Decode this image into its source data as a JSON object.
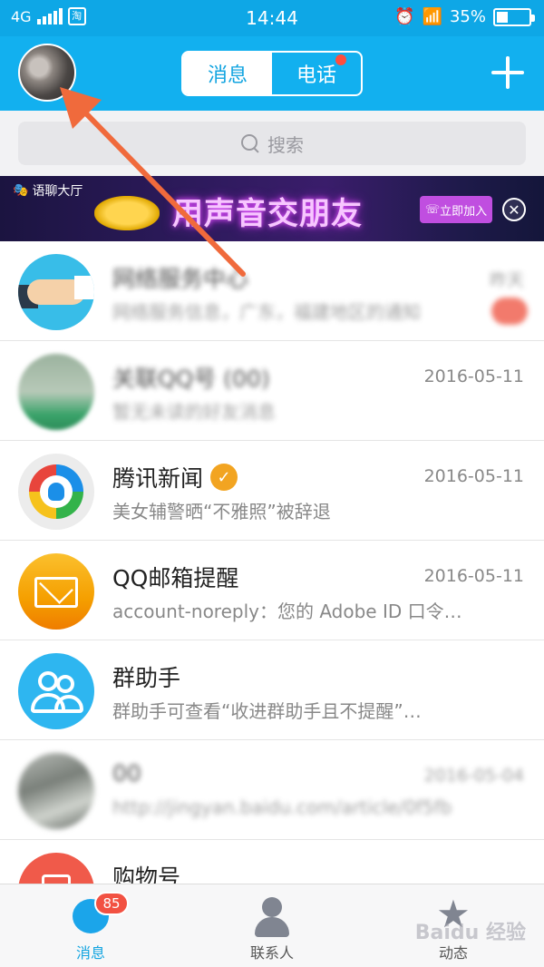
{
  "status_bar": {
    "network": "4G",
    "app_badge": "淘",
    "time": "14:44",
    "battery": "35%",
    "battery_level": 0.35
  },
  "header": {
    "tabs": [
      {
        "label": "消息",
        "active": true
      },
      {
        "label": "电话",
        "active": false,
        "has_dot": true
      }
    ],
    "avatar_icon": "user-avatar",
    "add_icon": "plus-icon"
  },
  "search": {
    "placeholder": "搜索"
  },
  "banner": {
    "brand": "语聊大厅",
    "slogan": "用声音交朋友",
    "join_label": "立即加入",
    "close_icon": "close-icon"
  },
  "chats": [
    {
      "name": "网络服务中心",
      "time": "昨天",
      "preview": "网络服务信息，广东，福建地区的通知",
      "blurred": true,
      "unread": true,
      "avatar": "handshake-avatar"
    },
    {
      "name": "关联QQ号 (00)",
      "time": "2016-05-11",
      "preview": "暂无未读的好友消息",
      "blurred": true,
      "avatar": "blurred-avatar"
    },
    {
      "name": "腾讯新闻",
      "time": "2016-05-11",
      "preview": "美女辅警晒“不雅照”被辞退",
      "verified": true,
      "avatar": "tencent-news-avatar"
    },
    {
      "name": "QQ邮箱提醒",
      "time": "2016-05-11",
      "preview": "account-noreply：您的 Adobe ID 口令…",
      "avatar": "mail-avatar"
    },
    {
      "name": "群助手",
      "time": "",
      "preview": "群助手可查看“收进群助手且不提醒”…",
      "avatar": "group-helper-avatar"
    },
    {
      "name": "00",
      "time": "2016-05-04",
      "preview": "http://jingyan.baidu.com/article/0f5fb",
      "blurred": true,
      "avatar": "blurred-avatar"
    },
    {
      "name": "购物号",
      "time": "",
      "preview": "",
      "avatar": "shopping-avatar"
    }
  ],
  "bottom_nav": [
    {
      "label": "消息",
      "active": true,
      "badge": "85",
      "icon": "message-icon"
    },
    {
      "label": "联系人",
      "active": false,
      "icon": "contacts-icon"
    },
    {
      "label": "动态",
      "active": false,
      "icon": "star-icon"
    }
  ],
  "colors": {
    "header_blue": "#12b0ef",
    "badge_red": "#f25142",
    "arrow_orange": "#f06a3c"
  },
  "watermark": "Baidu 经验"
}
